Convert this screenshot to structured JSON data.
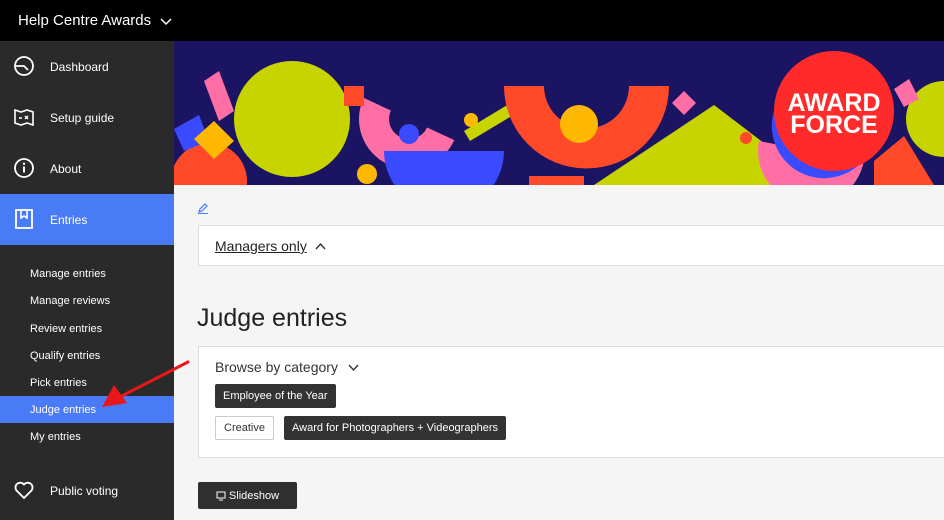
{
  "topbar": {
    "title": "Help Centre Awards"
  },
  "sidebar": {
    "items": [
      {
        "label": "Dashboard",
        "icon": "dashboard-icon"
      },
      {
        "label": "Setup guide",
        "icon": "setup-guide-icon"
      },
      {
        "label": "About",
        "icon": "info-icon"
      },
      {
        "label": "Entries",
        "icon": "bookmark-icon"
      },
      {
        "label": "Public voting",
        "icon": "heart-icon"
      }
    ],
    "sub_items": [
      "Manage entries",
      "Manage reviews",
      "Review entries",
      "Qualify entries",
      "Pick entries",
      "Judge entries",
      "My entries"
    ]
  },
  "banner": {
    "logo_line1": "AWARD",
    "logo_line2": "FORCE"
  },
  "managers": {
    "label": "Managers only"
  },
  "page": {
    "title": "Judge entries"
  },
  "browse": {
    "label": "Browse by category",
    "chips": [
      "Employee of the Year",
      "Creative",
      "Award for Photographers + Videographers"
    ]
  },
  "slideshow": {
    "label": "Slideshow"
  },
  "colors": {
    "accent": "#4a7bf7",
    "sidebar": "#2a2a2a",
    "banner": "#1a1462",
    "arrow": "#e8171a"
  }
}
